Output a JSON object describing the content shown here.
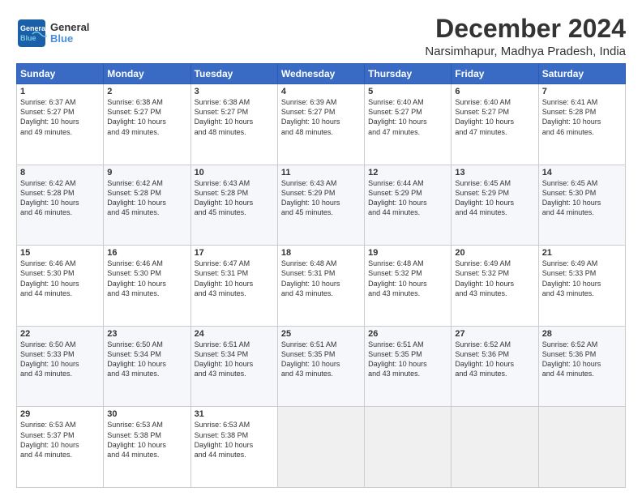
{
  "logo": {
    "line1": "General",
    "line2": "Blue"
  },
  "title": "December 2024",
  "subtitle": "Narsimhapur, Madhya Pradesh, India",
  "columns": [
    "Sunday",
    "Monday",
    "Tuesday",
    "Wednesday",
    "Thursday",
    "Friday",
    "Saturday"
  ],
  "weeks": [
    [
      {
        "day": "1",
        "info": "Sunrise: 6:37 AM\nSunset: 5:27 PM\nDaylight: 10 hours\nand 49 minutes."
      },
      {
        "day": "2",
        "info": "Sunrise: 6:38 AM\nSunset: 5:27 PM\nDaylight: 10 hours\nand 49 minutes."
      },
      {
        "day": "3",
        "info": "Sunrise: 6:38 AM\nSunset: 5:27 PM\nDaylight: 10 hours\nand 48 minutes."
      },
      {
        "day": "4",
        "info": "Sunrise: 6:39 AM\nSunset: 5:27 PM\nDaylight: 10 hours\nand 48 minutes."
      },
      {
        "day": "5",
        "info": "Sunrise: 6:40 AM\nSunset: 5:27 PM\nDaylight: 10 hours\nand 47 minutes."
      },
      {
        "day": "6",
        "info": "Sunrise: 6:40 AM\nSunset: 5:27 PM\nDaylight: 10 hours\nand 47 minutes."
      },
      {
        "day": "7",
        "info": "Sunrise: 6:41 AM\nSunset: 5:28 PM\nDaylight: 10 hours\nand 46 minutes."
      }
    ],
    [
      {
        "day": "8",
        "info": "Sunrise: 6:42 AM\nSunset: 5:28 PM\nDaylight: 10 hours\nand 46 minutes."
      },
      {
        "day": "9",
        "info": "Sunrise: 6:42 AM\nSunset: 5:28 PM\nDaylight: 10 hours\nand 45 minutes."
      },
      {
        "day": "10",
        "info": "Sunrise: 6:43 AM\nSunset: 5:28 PM\nDaylight: 10 hours\nand 45 minutes."
      },
      {
        "day": "11",
        "info": "Sunrise: 6:43 AM\nSunset: 5:29 PM\nDaylight: 10 hours\nand 45 minutes."
      },
      {
        "day": "12",
        "info": "Sunrise: 6:44 AM\nSunset: 5:29 PM\nDaylight: 10 hours\nand 44 minutes."
      },
      {
        "day": "13",
        "info": "Sunrise: 6:45 AM\nSunset: 5:29 PM\nDaylight: 10 hours\nand 44 minutes."
      },
      {
        "day": "14",
        "info": "Sunrise: 6:45 AM\nSunset: 5:30 PM\nDaylight: 10 hours\nand 44 minutes."
      }
    ],
    [
      {
        "day": "15",
        "info": "Sunrise: 6:46 AM\nSunset: 5:30 PM\nDaylight: 10 hours\nand 44 minutes."
      },
      {
        "day": "16",
        "info": "Sunrise: 6:46 AM\nSunset: 5:30 PM\nDaylight: 10 hours\nand 43 minutes."
      },
      {
        "day": "17",
        "info": "Sunrise: 6:47 AM\nSunset: 5:31 PM\nDaylight: 10 hours\nand 43 minutes."
      },
      {
        "day": "18",
        "info": "Sunrise: 6:48 AM\nSunset: 5:31 PM\nDaylight: 10 hours\nand 43 minutes."
      },
      {
        "day": "19",
        "info": "Sunrise: 6:48 AM\nSunset: 5:32 PM\nDaylight: 10 hours\nand 43 minutes."
      },
      {
        "day": "20",
        "info": "Sunrise: 6:49 AM\nSunset: 5:32 PM\nDaylight: 10 hours\nand 43 minutes."
      },
      {
        "day": "21",
        "info": "Sunrise: 6:49 AM\nSunset: 5:33 PM\nDaylight: 10 hours\nand 43 minutes."
      }
    ],
    [
      {
        "day": "22",
        "info": "Sunrise: 6:50 AM\nSunset: 5:33 PM\nDaylight: 10 hours\nand 43 minutes."
      },
      {
        "day": "23",
        "info": "Sunrise: 6:50 AM\nSunset: 5:34 PM\nDaylight: 10 hours\nand 43 minutes."
      },
      {
        "day": "24",
        "info": "Sunrise: 6:51 AM\nSunset: 5:34 PM\nDaylight: 10 hours\nand 43 minutes."
      },
      {
        "day": "25",
        "info": "Sunrise: 6:51 AM\nSunset: 5:35 PM\nDaylight: 10 hours\nand 43 minutes."
      },
      {
        "day": "26",
        "info": "Sunrise: 6:51 AM\nSunset: 5:35 PM\nDaylight: 10 hours\nand 43 minutes."
      },
      {
        "day": "27",
        "info": "Sunrise: 6:52 AM\nSunset: 5:36 PM\nDaylight: 10 hours\nand 43 minutes."
      },
      {
        "day": "28",
        "info": "Sunrise: 6:52 AM\nSunset: 5:36 PM\nDaylight: 10 hours\nand 44 minutes."
      }
    ],
    [
      {
        "day": "29",
        "info": "Sunrise: 6:53 AM\nSunset: 5:37 PM\nDaylight: 10 hours\nand 44 minutes."
      },
      {
        "day": "30",
        "info": "Sunrise: 6:53 AM\nSunset: 5:38 PM\nDaylight: 10 hours\nand 44 minutes."
      },
      {
        "day": "31",
        "info": "Sunrise: 6:53 AM\nSunset: 5:38 PM\nDaylight: 10 hours\nand 44 minutes."
      },
      {
        "day": "",
        "info": ""
      },
      {
        "day": "",
        "info": ""
      },
      {
        "day": "",
        "info": ""
      },
      {
        "day": "",
        "info": ""
      }
    ]
  ]
}
